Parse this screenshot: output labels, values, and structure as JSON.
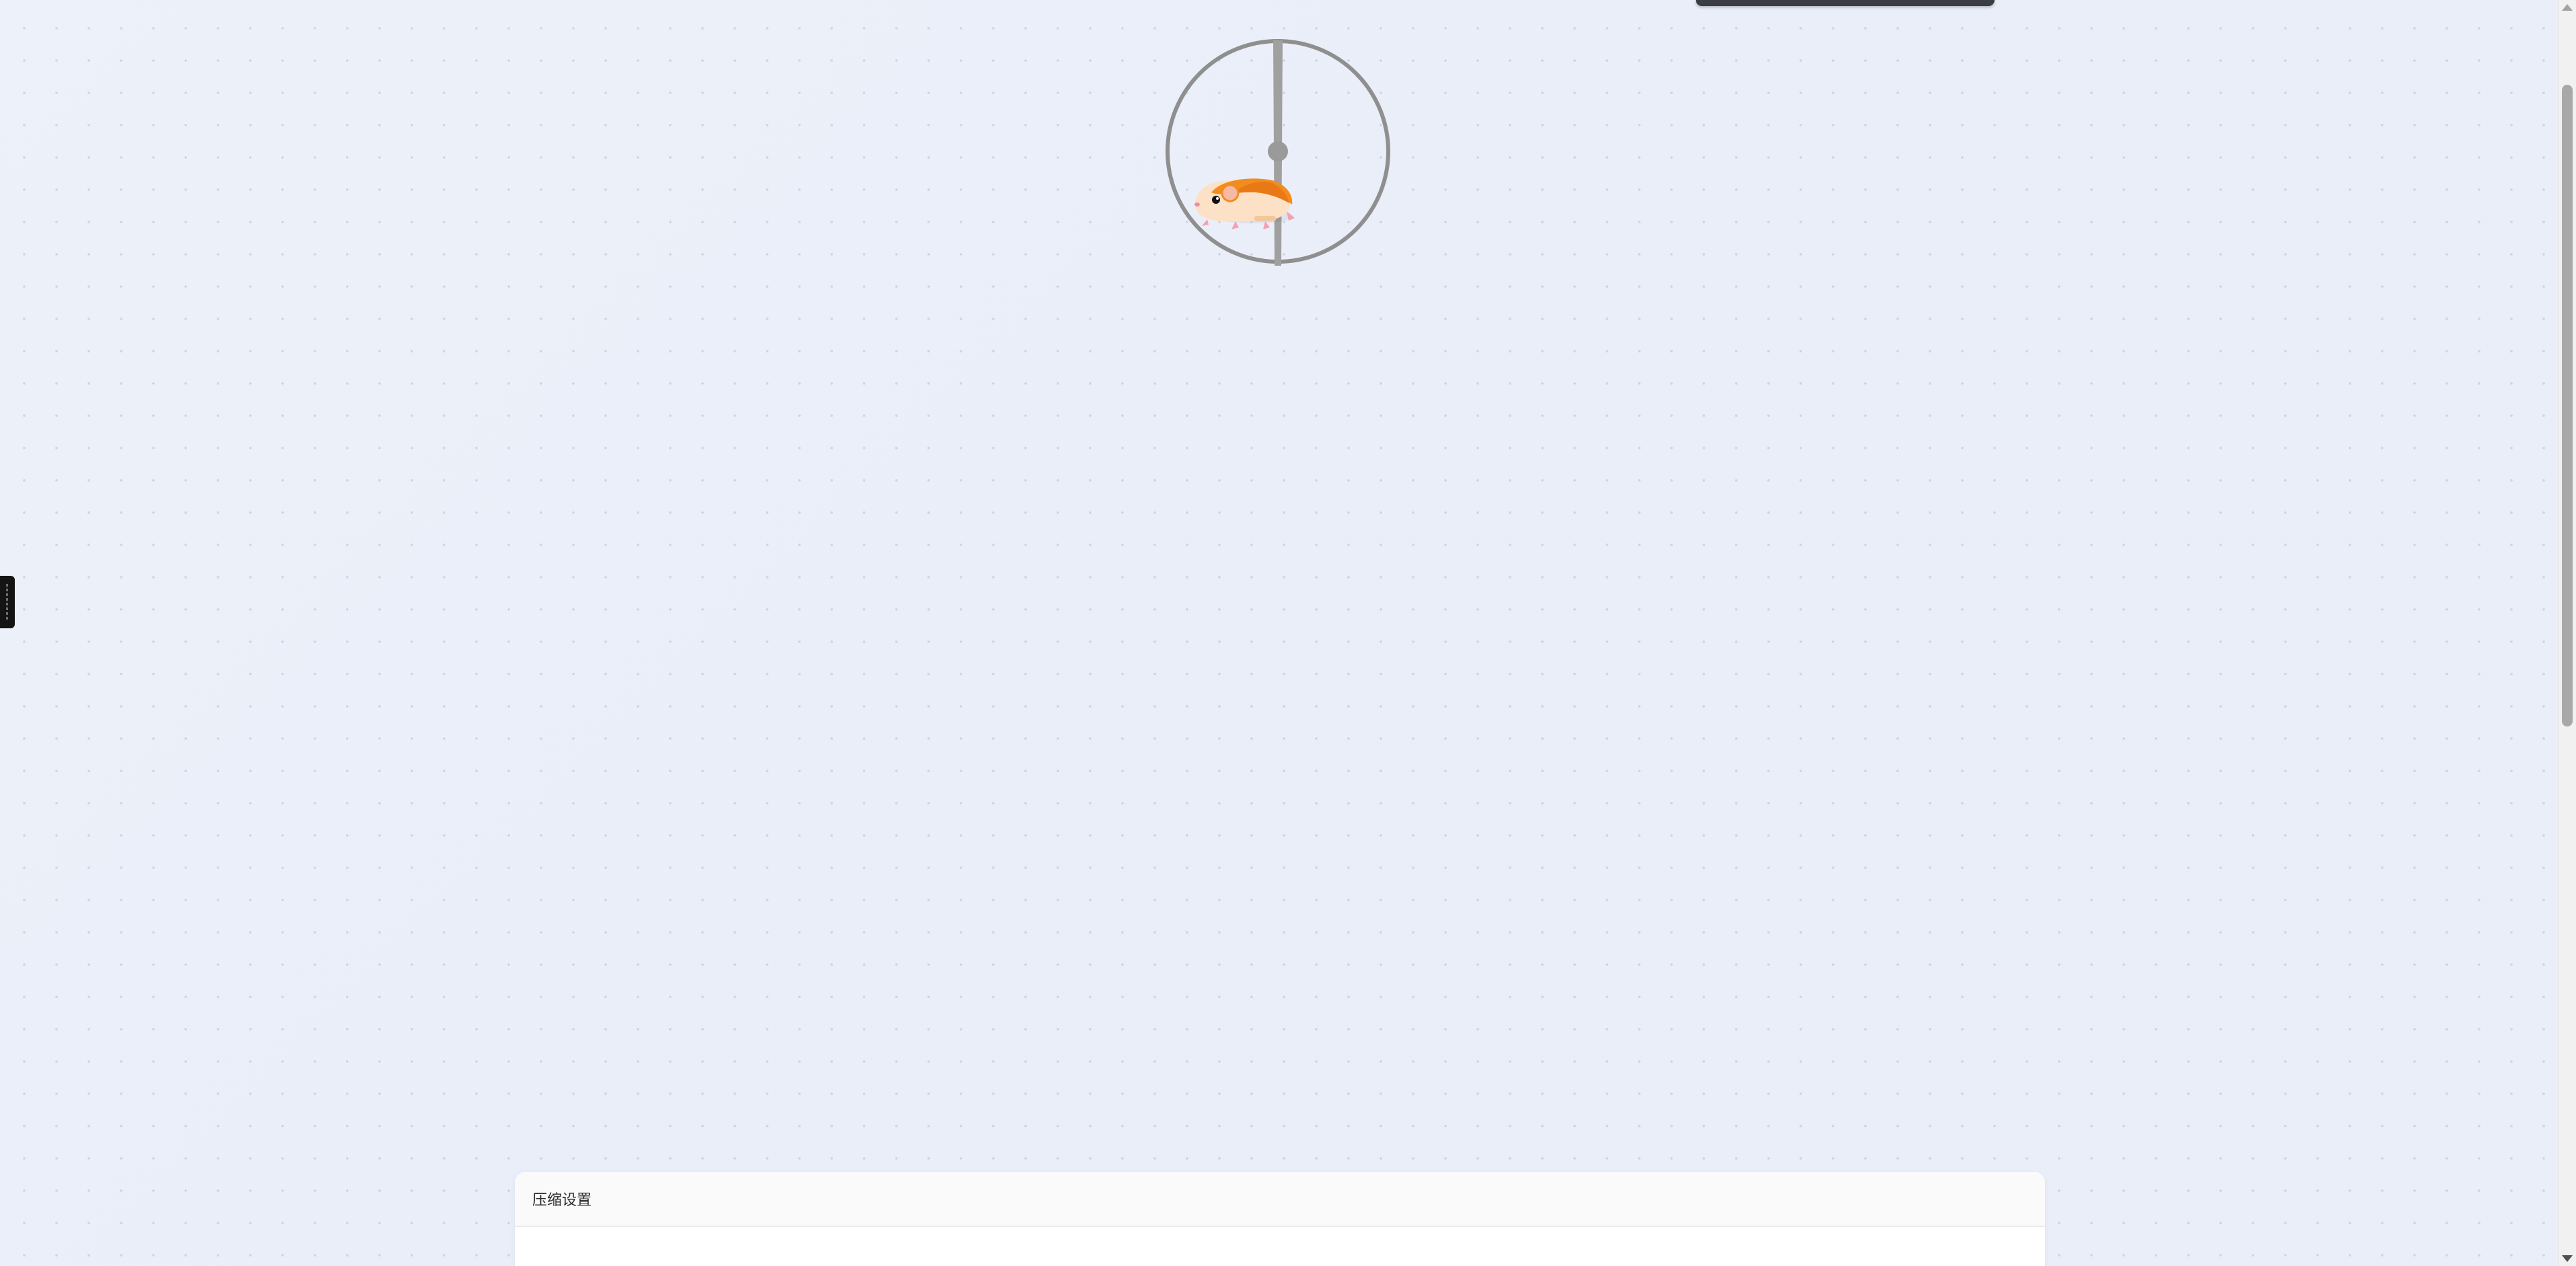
{
  "loading": {
    "animation": "hamster-wheel"
  },
  "settings_panel": {
    "title": "压缩设置"
  },
  "icons": {
    "side_handle": "drag-handle-icon",
    "scroll_up": "chevron-up-icon",
    "scroll_down": "chevron-down-icon"
  },
  "colors": {
    "background": "#edf1f9",
    "wheel": "#8f8f8f",
    "hamster_fur": "#f28c1e",
    "hamster_body": "#fde1c6",
    "card_header": "#fafafa"
  }
}
